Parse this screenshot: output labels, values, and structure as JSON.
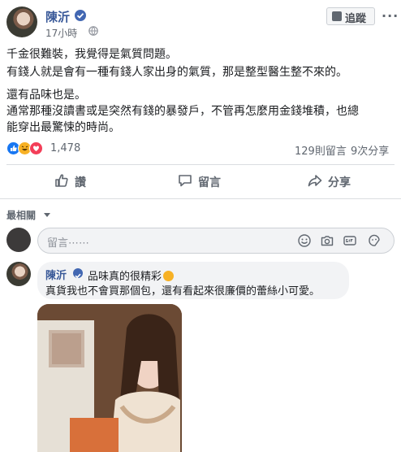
{
  "post": {
    "author": "陳沂",
    "timestamp": "17小時",
    "follow_label": "追蹤",
    "more_label": "···",
    "lines": [
      "千金很難裝，我覺得是氣質問題。",
      "有錢人就是會有一種有錢人家出身的氣質，那是整型醫生整不來的。",
      "還有品味也是。",
      "通常那種沒讀書或是突然有錢的暴發戶，不管再怎麼用金錢堆積，也總",
      "能穿出最驚悚的時尚。"
    ]
  },
  "reactions": {
    "icons": [
      "like-icon",
      "haha-icon",
      "love-icon"
    ],
    "count": "1,478",
    "comments": "129則留言",
    "shares": "9次分享"
  },
  "actions": {
    "like": "讚",
    "comment": "留言",
    "share": "分享"
  },
  "comments_section": {
    "sort_label": "最相關",
    "input_placeholder": "留言⋯⋯",
    "input_icons": [
      "emoji-icon",
      "camera-icon",
      "gif-icon",
      "sticker-icon"
    ]
  },
  "reply": {
    "author": "陳沂",
    "line1": "品味真的很精彩",
    "line2": "真貨我也不會買那個包，還有看起來很廉價的蕾絲小可愛。"
  },
  "colors": {
    "link_blue": "#385898",
    "verified_blue": "#4267b2",
    "meta_gray": "#606770"
  }
}
